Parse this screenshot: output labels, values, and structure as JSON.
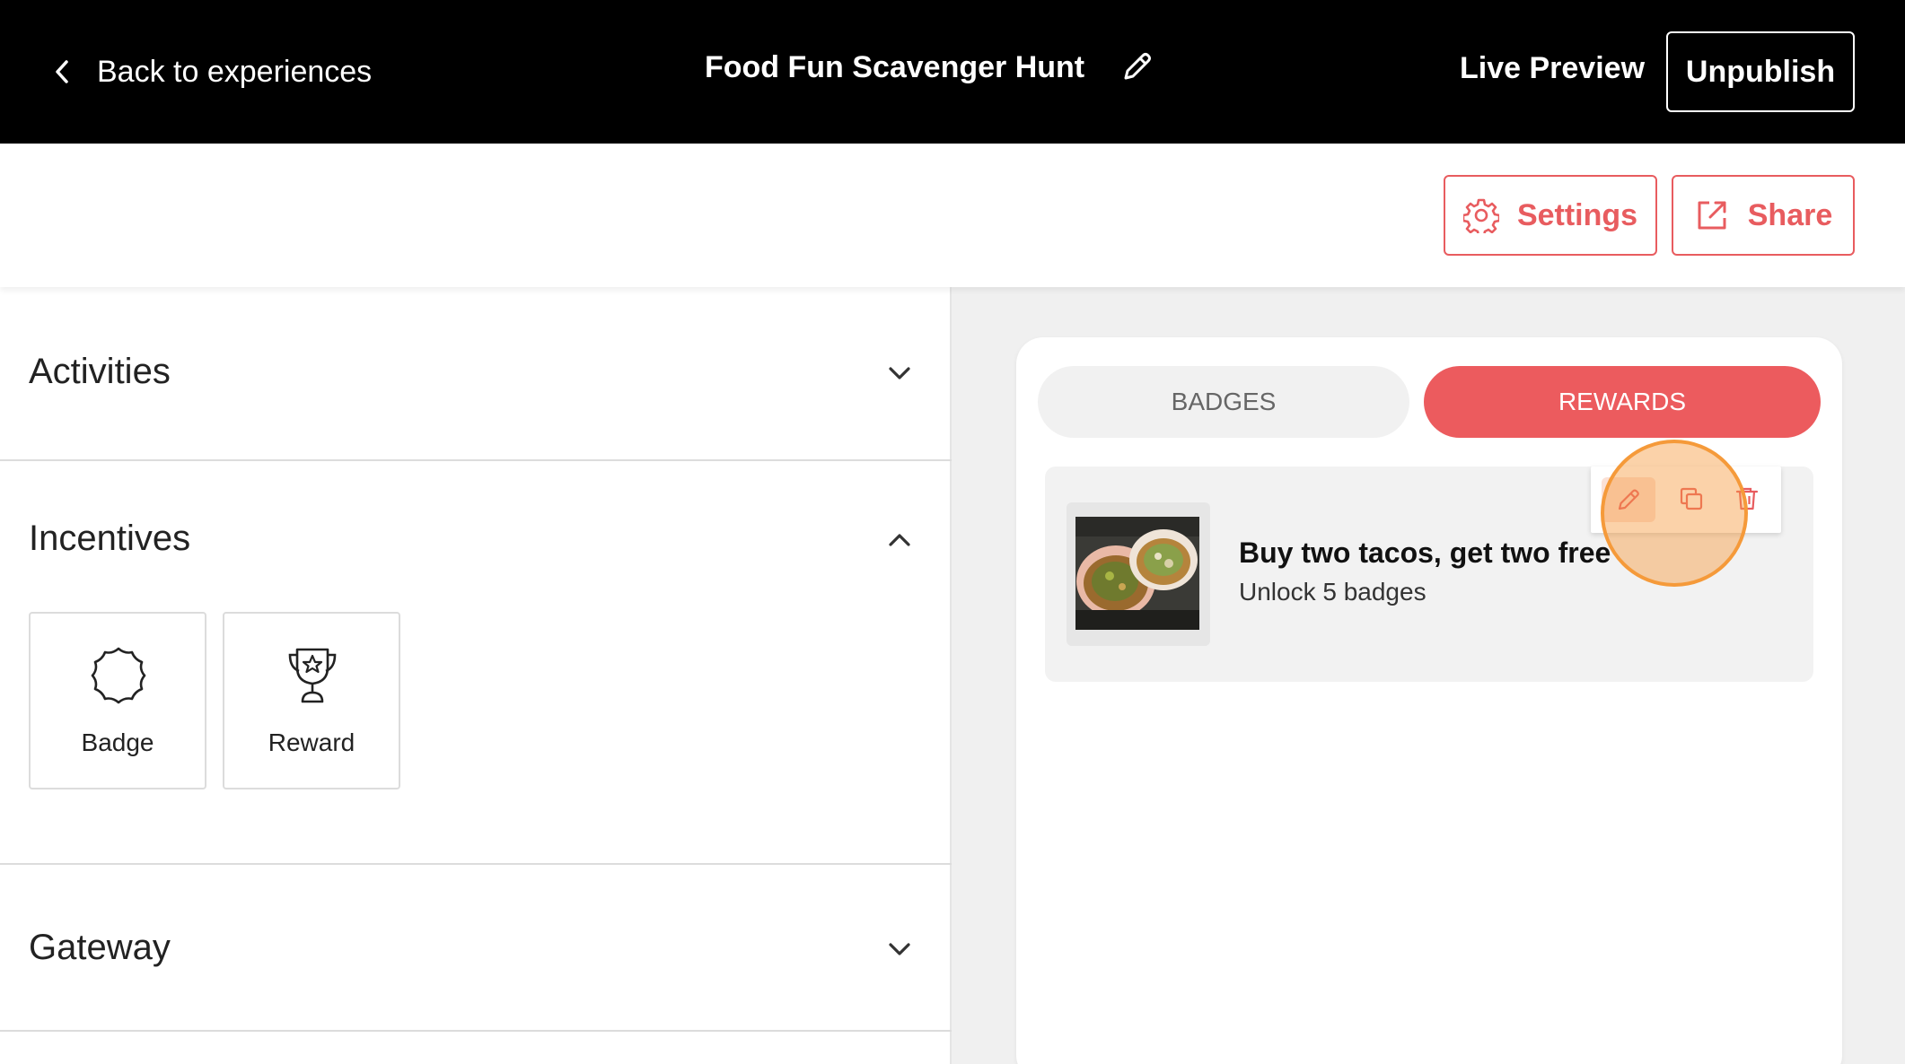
{
  "header": {
    "back_label": "Back to experiences",
    "title": "Food Fun Scavenger Hunt",
    "live_preview_label": "Live Preview",
    "unpublish_label": "Unpublish"
  },
  "toolbar": {
    "settings_label": "Settings",
    "share_label": "Share"
  },
  "sidebar": {
    "sections": [
      {
        "label": "Activities",
        "state": "collapsed"
      },
      {
        "label": "Incentives",
        "state": "expanded"
      },
      {
        "label": "Gateway",
        "state": "collapsed"
      }
    ],
    "incentive_tiles": [
      {
        "label": "Badge",
        "icon": "badge-icon"
      },
      {
        "label": "Reward",
        "icon": "trophy-icon"
      }
    ]
  },
  "preview": {
    "tabs": [
      {
        "label": "BADGES",
        "active": false
      },
      {
        "label": "REWARDS",
        "active": true
      }
    ],
    "rewards": [
      {
        "title": "Buy two tacos, get two free",
        "subtitle": "Unlock 5 badges",
        "image": "tacos-photo",
        "actions": [
          "pencil-icon",
          "copy-icon",
          "trash-icon"
        ]
      }
    ]
  },
  "colors": {
    "accent": "#ec5b5e",
    "topbar_bg": "#000000",
    "panel_bg": "#f0f0f0",
    "highlight": "#f59a3a"
  }
}
